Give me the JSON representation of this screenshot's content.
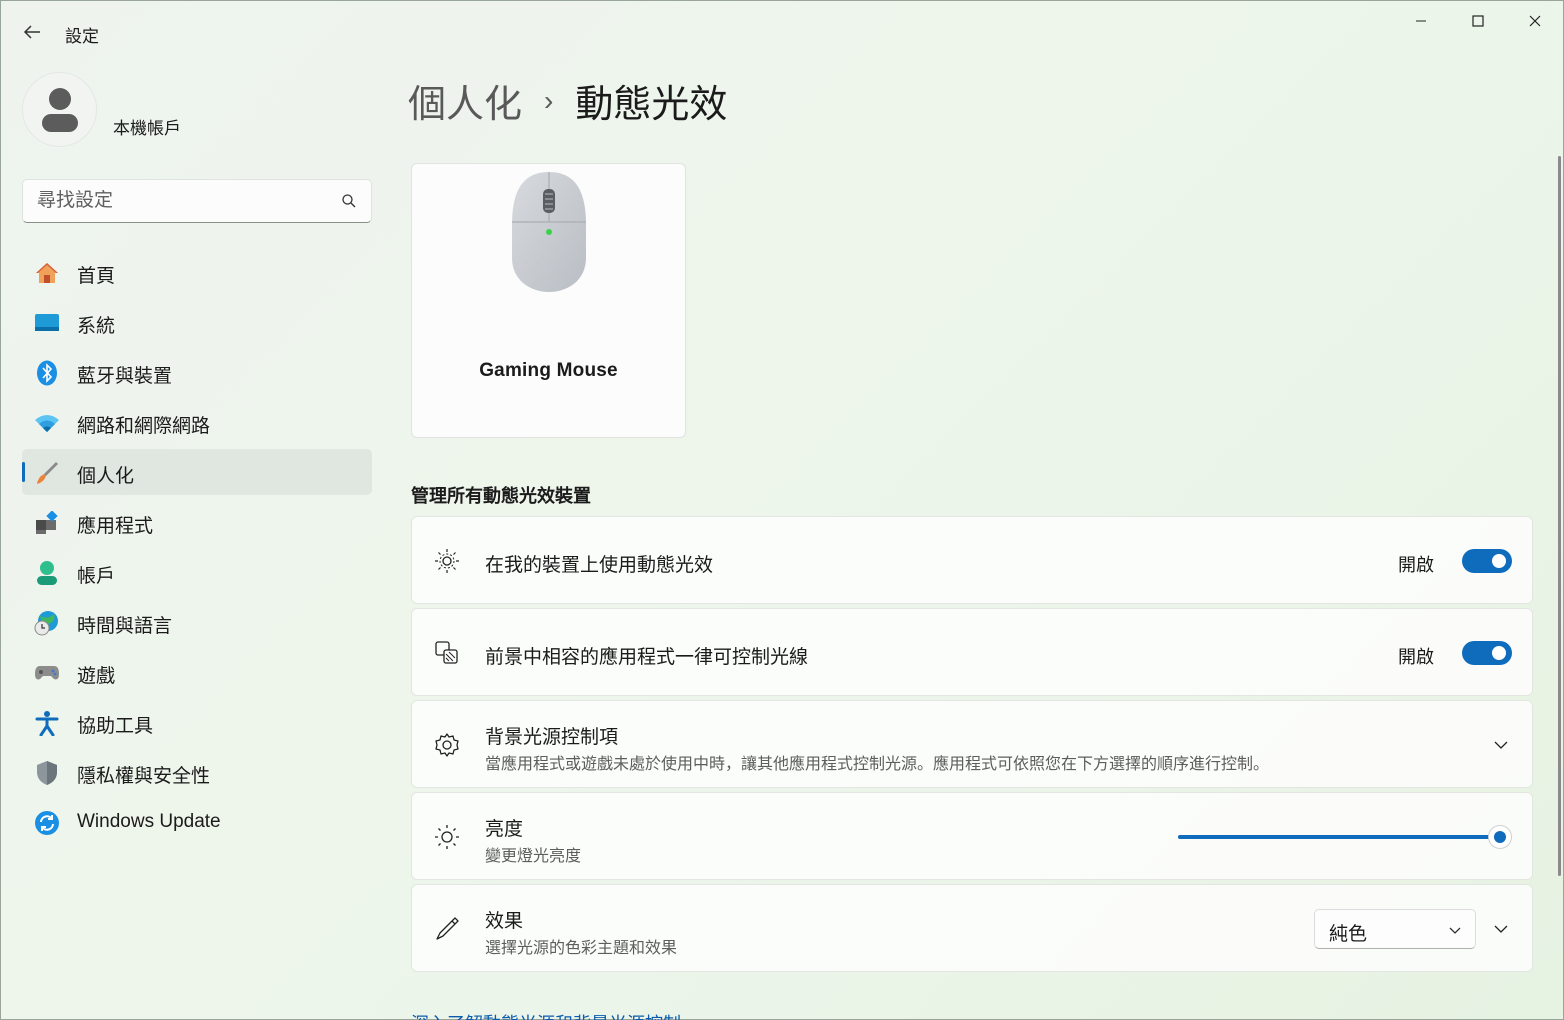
{
  "window": {
    "title": "設定",
    "back_label": "←"
  },
  "account": {
    "name": "本機帳戶"
  },
  "search": {
    "placeholder": "尋找設定"
  },
  "sidebar": {
    "items": [
      {
        "label": "首頁",
        "icon": "home-icon"
      },
      {
        "label": "系統",
        "icon": "system-icon"
      },
      {
        "label": "藍牙與裝置",
        "icon": "bluetooth-icon"
      },
      {
        "label": "網路和網際網路",
        "icon": "wifi-icon"
      },
      {
        "label": "個人化",
        "icon": "brush-icon",
        "active": true
      },
      {
        "label": "應用程式",
        "icon": "apps-icon"
      },
      {
        "label": "帳戶",
        "icon": "account-icon"
      },
      {
        "label": "時間與語言",
        "icon": "globe-clock-icon"
      },
      {
        "label": "遊戲",
        "icon": "gamepad-icon"
      },
      {
        "label": "協助工具",
        "icon": "accessibility-icon"
      },
      {
        "label": "隱私權與安全性",
        "icon": "shield-icon"
      },
      {
        "label": "Windows Update",
        "icon": "update-icon"
      }
    ]
  },
  "breadcrumb": {
    "parent": "個人化",
    "separator": "›",
    "current": "動態光效"
  },
  "device": {
    "name": "Gaming Mouse",
    "icon": "mouse-icon"
  },
  "section": {
    "title": "管理所有動態光效裝置"
  },
  "settings": {
    "use_dynamic_lighting": {
      "title": "在我的裝置上使用動態光效",
      "state_label": "開啟",
      "on": true,
      "icon": "dynamic-lighting-icon"
    },
    "foreground_apps": {
      "title": "前景中相容的應用程式一律可控制光線",
      "state_label": "開啟",
      "on": true,
      "icon": "foreground-apps-icon"
    },
    "background_controls": {
      "title": "背景光源控制項",
      "subtitle": "當應用程式或遊戲未處於使用中時，讓其他應用程式控制光源。應用程式可依照您在下方選擇的順序進行控制。",
      "icon": "gear-icon"
    },
    "brightness": {
      "title": "亮度",
      "subtitle": "變更燈光亮度",
      "value": 1.0,
      "icon": "brightness-icon"
    },
    "effects": {
      "title": "效果",
      "subtitle": "選擇光源的色彩主題和效果",
      "selected": "純色",
      "icon": "pen-icon"
    }
  },
  "footer": {
    "link": "深入了解動態光源和背景光源控制"
  },
  "colors": {
    "accent": "#0f6cbd"
  }
}
